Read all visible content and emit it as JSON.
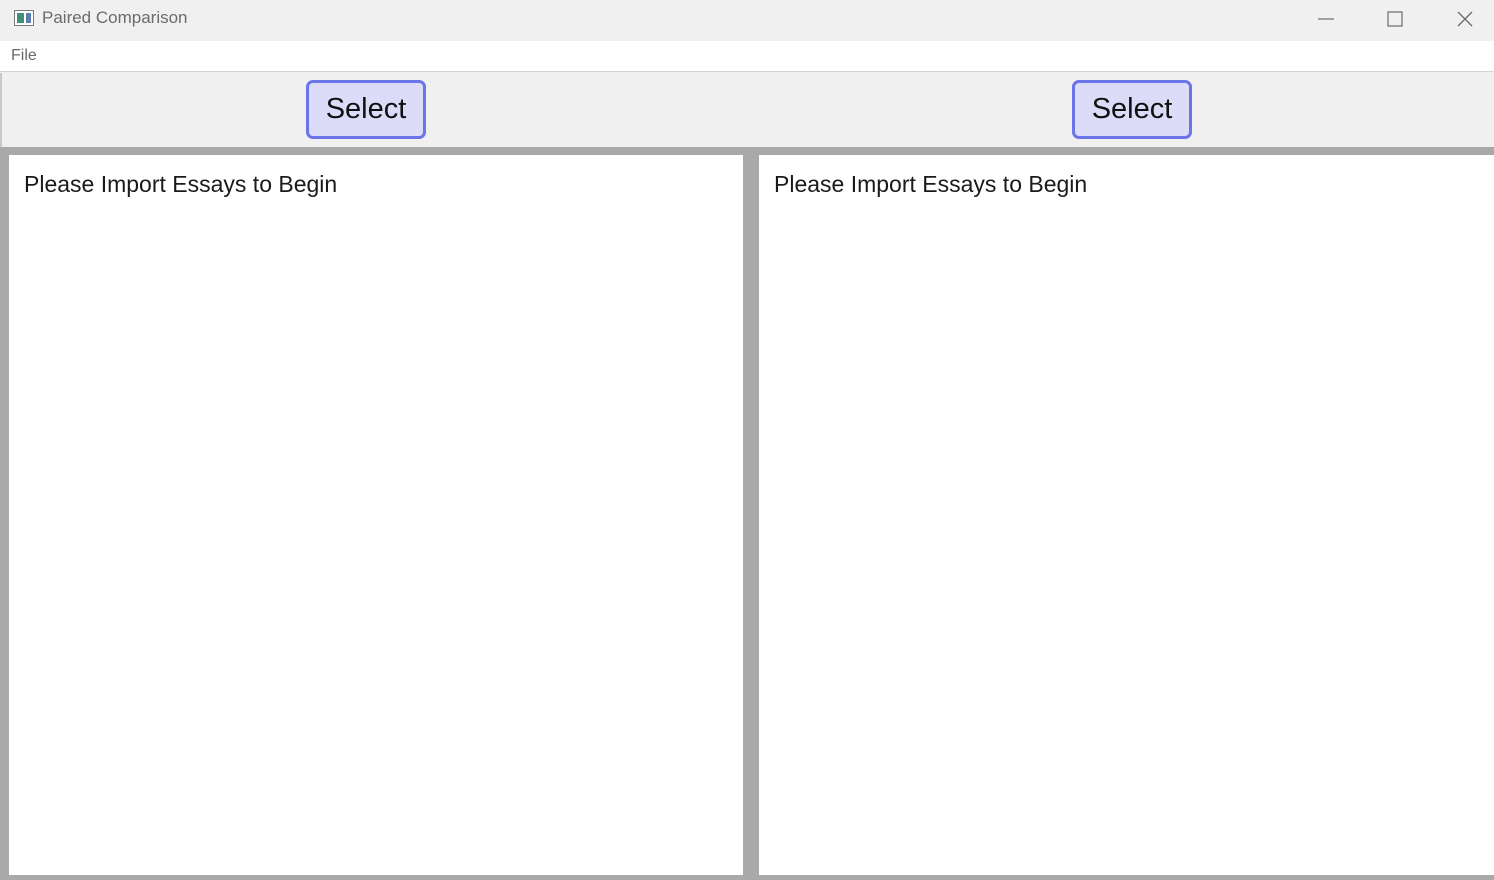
{
  "window": {
    "title": "Paired Comparison",
    "icon": "app-icon",
    "controls": {
      "minimize_icon": "minimize-icon",
      "maximize_icon": "maximize-icon",
      "close_icon": "close-icon"
    }
  },
  "menubar": {
    "items": [
      {
        "label": "File"
      }
    ]
  },
  "toolbar": {
    "left_button_label": "Select",
    "right_button_label": "Select",
    "button_color": "#dcdcf8",
    "button_border_color": "#6b74e8"
  },
  "panes": {
    "left": {
      "text": "Please Import Essays to Begin"
    },
    "right": {
      "text": "Please Import Essays to Begin"
    }
  }
}
